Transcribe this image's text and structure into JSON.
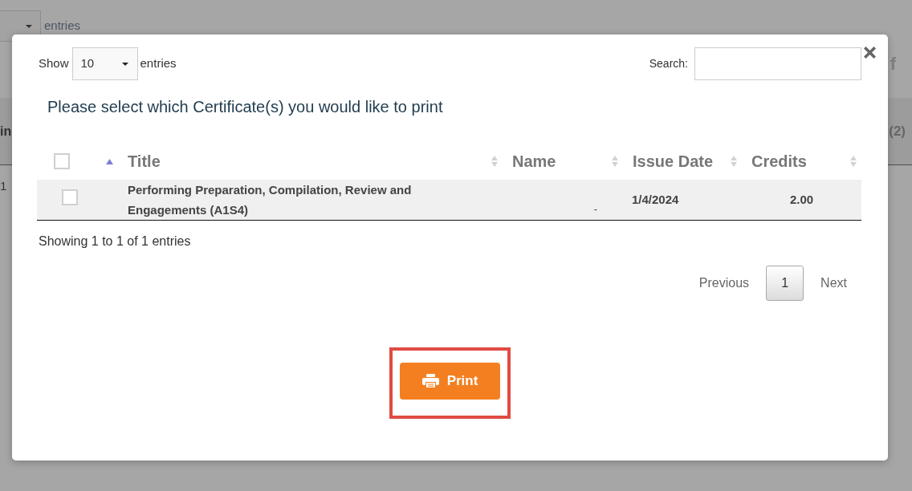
{
  "background_page": {
    "entries_label": "entries",
    "top_right_text": "f",
    "header_left_text": "in",
    "header_right_text": "(2)",
    "row_text": "1"
  },
  "dialog": {
    "length_menu": {
      "label_before": "Show",
      "value": "10",
      "label_after": "entries"
    },
    "search": {
      "label": "Search:"
    },
    "heading": "Please select which Certificate(s) you would like to print",
    "table": {
      "columns": [
        {
          "kind": "select",
          "checked": false,
          "sorted": true
        },
        {
          "kind": "text",
          "label": "Title",
          "sorted": false
        },
        {
          "kind": "text",
          "label": "Name",
          "sorted": false
        },
        {
          "kind": "text",
          "label": "Issue Date",
          "sorted": false
        },
        {
          "kind": "text",
          "label": "Credits",
          "sorted": false
        }
      ],
      "rows": [
        {
          "checked": false,
          "title": "Performing Preparation, Compilation, Review and Engagements (A1S4)",
          "name": "-",
          "issue_date": "1/4/2024",
          "credits": "2.00"
        }
      ]
    },
    "info": "Showing 1 to 1 of 1 entries",
    "pagination": {
      "previous": "Previous",
      "pages": [
        {
          "label": "1",
          "selected": true
        }
      ],
      "next": "Next"
    },
    "print_button": {
      "label": "Print",
      "highlighted": true
    }
  }
}
